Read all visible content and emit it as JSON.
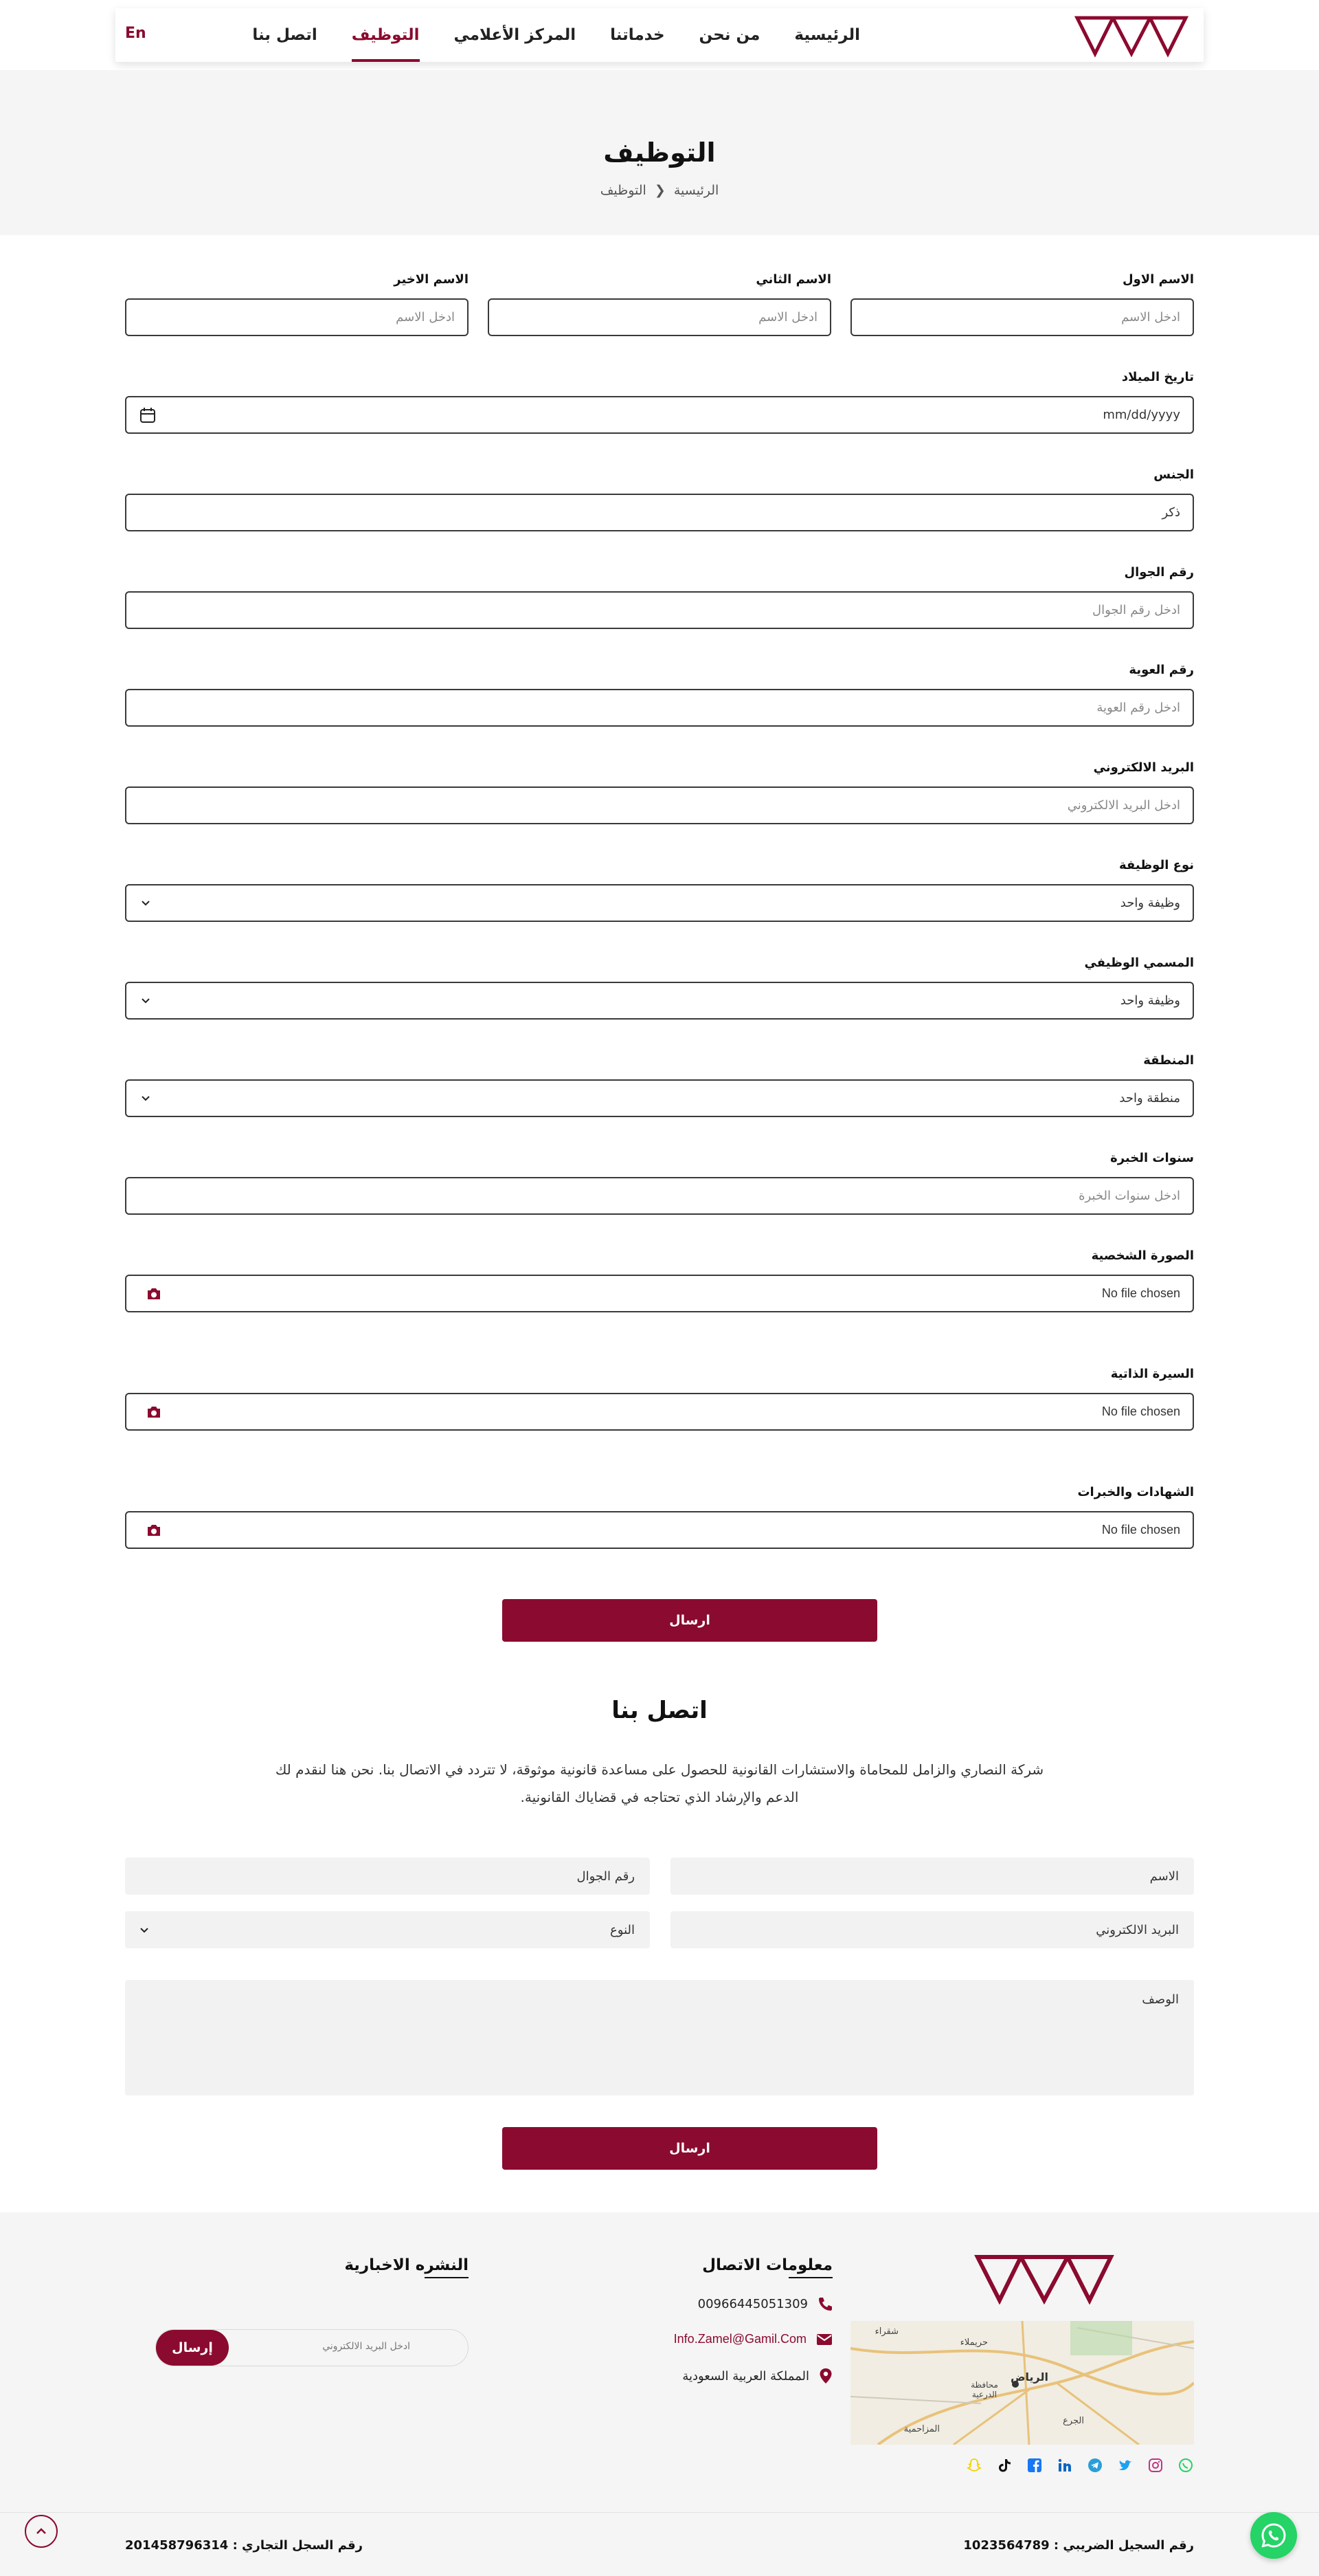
{
  "header": {
    "nav": [
      {
        "label": "الرئيسية",
        "active": false
      },
      {
        "label": "من نحن",
        "active": false
      },
      {
        "label": "خدماتنا",
        "active": false
      },
      {
        "label": "المركز الأعلامي",
        "active": false
      },
      {
        "label": "التوظيف",
        "active": true
      },
      {
        "label": "اتصل بنا",
        "active": false
      }
    ],
    "lang": "En"
  },
  "hero": {
    "title": "التوظيف",
    "breadcrumb_home": "الرئيسية",
    "breadcrumb_current": "التوظيف"
  },
  "form": {
    "first_name": {
      "label": "الاسم الاول",
      "placeholder": "ادخل الاسم"
    },
    "second_name": {
      "label": "الاسم الثاني",
      "placeholder": "ادخل الاسم"
    },
    "last_name": {
      "label": "الاسم الاخير",
      "placeholder": "ادخل الاسم"
    },
    "birth_date": {
      "label": "تاريخ الميلاد",
      "placeholder": "mm/dd/yyyy"
    },
    "gender": {
      "label": "الجنس",
      "value": "ذكر"
    },
    "mobile": {
      "label": "رقم الجوال",
      "placeholder": "ادخل رقم الجوال"
    },
    "id_number": {
      "label": "رقم العوية",
      "placeholder": "ادخل رقم العوية"
    },
    "email": {
      "label": "البريد الالكتروني",
      "placeholder": "ادخل البريد الالكتروني"
    },
    "job_type": {
      "label": "نوع الوظيفة",
      "value": "وظيفة واحد"
    },
    "job_title": {
      "label": "المسمي الوظيفي",
      "value": "وظيفة واحد"
    },
    "region": {
      "label": "المنطقة",
      "value": "منطقة واحد"
    },
    "experience": {
      "label": "سنوات الخبرة",
      "placeholder": "ادخل سنوات الخبرة"
    },
    "photo": {
      "label": "الصورة الشخصية",
      "value": "No file chosen"
    },
    "cv": {
      "label": "السيرة الذاتية",
      "value": "No file chosen"
    },
    "certificates": {
      "label": "الشهادات والخبرات",
      "value": "No file chosen"
    },
    "submit": "ارسال"
  },
  "contact": {
    "title": "اتصل بنا",
    "text_line1": "شركة النصاري والزامل للمحاماة والاستشارات القانونية للحصول على مساعدة قانونية موثوقة، لا تتردد في الاتصال بنا. نحن هنا لنقدم لك",
    "text_line2": "الدعم والإرشاد الذي تحتاجه في قضاياك القانونية.",
    "name": "الاسم",
    "mobile": "رقم الجوال",
    "email": "البريد الالكتروني",
    "type": "النوع",
    "description": "الوصف",
    "submit": "ارسال"
  },
  "footer": {
    "contact_heading": "معلومات الاتصال",
    "phone": "00966445051309",
    "email": "Info.Zamel@Gamil.Com",
    "address": "المملكة العربية السعودية",
    "newsletter_heading": "النشره الاخبارية",
    "newsletter_placeholder": "ادخل البريد الالكتروني",
    "newsletter_button": "إرسال",
    "tax_number": "رقم السجيل الضريبي : 1023564789",
    "commercial_number": "رقم السجل التجاري : 201458796314",
    "map_labels": [
      "الرياض",
      "محافظة الدرعية",
      "حريملاء",
      "الجرع",
      "المزاحمية",
      "شقراء"
    ],
    "socials": [
      "whatsapp-icon",
      "instagram-icon",
      "twitter-icon",
      "telegram-icon",
      "linkedin-icon",
      "facebook-icon",
      "tiktok-icon",
      "snapchat-icon"
    ]
  },
  "colors": {
    "accent": "#8b0a2f",
    "hero_bg": "#f5f5f5",
    "field_gray": "#f2f2f2",
    "whatsapp": "#25d366"
  }
}
